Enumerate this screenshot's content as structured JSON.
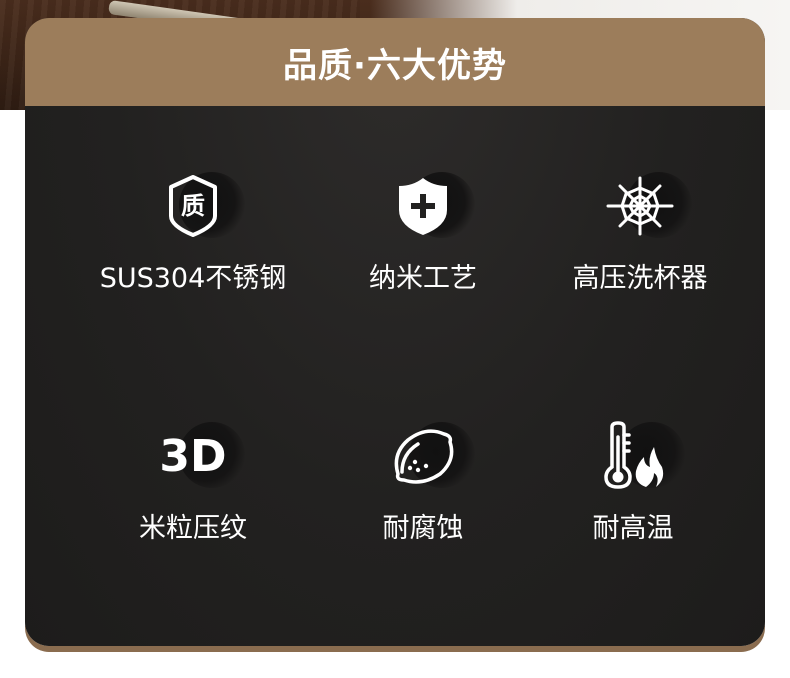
{
  "header": {
    "title": "品质·六大优势"
  },
  "features": [
    {
      "icon": "quality-badge-icon",
      "badge_text": "质",
      "label": "SUS304不锈钢"
    },
    {
      "icon": "shield-plus-icon",
      "label": "纳米工艺"
    },
    {
      "icon": "spray-icon",
      "label": "高压洗杯器"
    },
    {
      "icon": "3d-text-icon",
      "icon_text": "3D",
      "label": "米粒压纹"
    },
    {
      "icon": "lemon-icon",
      "label": "耐腐蚀"
    },
    {
      "icon": "thermometer-flame-icon",
      "label": "耐高温"
    }
  ],
  "colors": {
    "header_bar": "#9c7d5b",
    "card_background": "#222120",
    "text": "#ffffff"
  }
}
